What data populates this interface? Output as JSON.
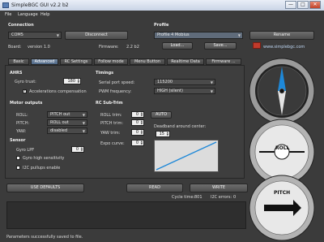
{
  "window": {
    "title": "SimpleBGC GUI v2.2 b2",
    "minimize": "—",
    "maximize": "□",
    "close": "✕"
  },
  "menu": {
    "items": [
      "File",
      "Language",
      "Help"
    ]
  },
  "connection": {
    "header": "Connection",
    "port": "COM5",
    "disconnect_label": "Disconnect",
    "board_label": "Board:",
    "board_value": "version 1.0",
    "firmware_label": "Firmware:",
    "firmware_value": "2.2 b2"
  },
  "profile": {
    "header": "Profile",
    "selected": "Profile 4 Mobius",
    "rename_label": "Rename",
    "load_label": "Load...",
    "save_label": "Save...",
    "site_url": "www.simplebgc.com"
  },
  "tabs": [
    "Basic",
    "Advanced",
    "RC Settings",
    "Follow mode",
    "Menu Button",
    "Realtime Data",
    "Firmware ..."
  ],
  "ahrs": {
    "header": "AHRS",
    "gyro_trust_label": "Gyro trust:",
    "gyro_trust_value": "180",
    "accel_comp_label": "Accelerations compensation",
    "accel_comp_checked": true
  },
  "motor_outputs": {
    "header": "Motor outputs",
    "roll_label": "ROLL:",
    "roll_value": "PITCH out",
    "pitch_label": "PITCH:",
    "pitch_value": "ROLL out",
    "yaw_label": "YAW:",
    "yaw_value": "disabled"
  },
  "sensor": {
    "header": "Sensor",
    "gyro_lpf_label": "Gyro LPF",
    "gyro_lpf_value": "0",
    "gyro_hs_label": "Gyro high sensitivity",
    "i2c_label": "I2C pullups enable"
  },
  "timings": {
    "header": "Timings",
    "serial_label": "Serial port speed:",
    "serial_value": "115200",
    "pwm_label": "PWM frequency:",
    "pwm_value": "HIGH (silent)"
  },
  "rc_subtrim": {
    "header": "RC Sub-Trim",
    "roll_trim_label": "ROLL trim:",
    "roll_trim_value": "0",
    "pitch_trim_label": "PITCH trim:",
    "pitch_trim_value": "0",
    "yaw_trim_label": "YAW trim:",
    "yaw_trim_value": "0",
    "expo_label": "Expo curve:",
    "expo_value": "0",
    "auto_label": "AUTO",
    "deadband_label": "Deadband around center:",
    "deadband_value": "15"
  },
  "actions": {
    "use_defaults_label": "USE DEFAULTS",
    "read_label": "READ",
    "write_label": "WRITE"
  },
  "status": {
    "cycle_time_label": "Cycle time:",
    "cycle_time_value": "801",
    "i2c_errors_label": "I2C errors:",
    "i2c_errors_value": "0",
    "message": "Parameters successfully saved to file."
  },
  "gauges": {
    "roll_label": "ROLL",
    "pitch_label": "PITCH"
  },
  "colors": {
    "accent_blue": "#1e88d8",
    "panel": "#3b3b3b",
    "chart_bg": "#dcdcdc"
  }
}
